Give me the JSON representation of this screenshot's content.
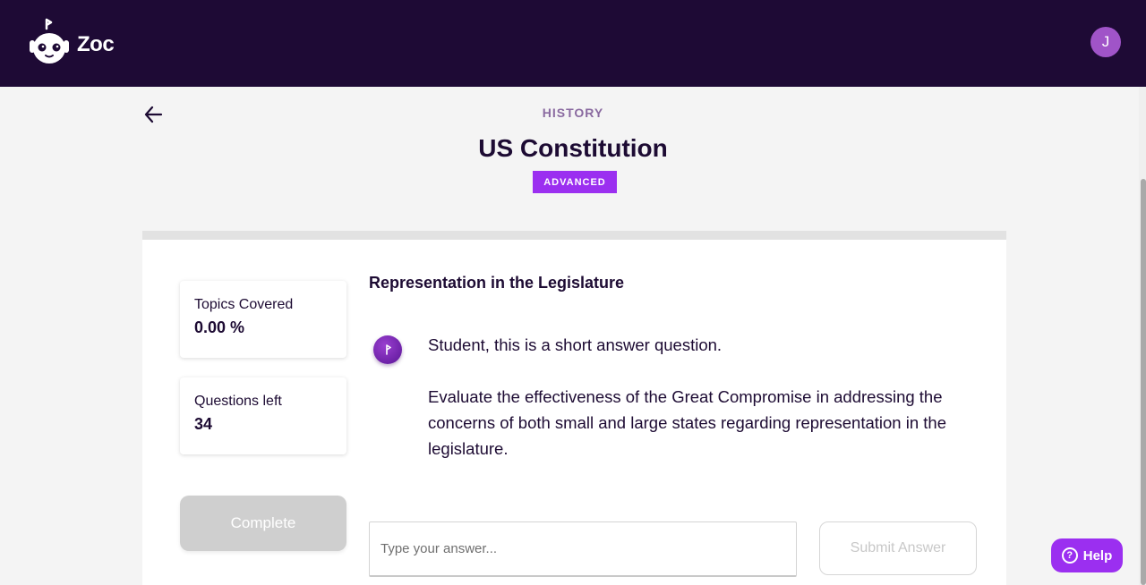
{
  "header": {
    "brand": "Zoc",
    "avatar_initial": "J"
  },
  "lesson": {
    "subject": "HISTORY",
    "title": "US Constitution",
    "level": "ADVANCED"
  },
  "stats": {
    "topics_covered_label": "Topics Covered",
    "topics_covered_value": "0.00 %",
    "questions_left_label": "Questions left",
    "questions_left_value": "34"
  },
  "actions": {
    "complete_label": "Complete",
    "submit_label": "Submit Answer",
    "help_label": "Help",
    "help_icon": "?"
  },
  "question": {
    "topic": "Representation in the Legislature",
    "intro": "Student, this is a short answer question.",
    "prompt": "Evaluate the effectiveness of the Great Compromise in addressing the concerns of both small and large states regarding representation in the legislature."
  },
  "answer": {
    "placeholder": "Type your answer..."
  },
  "colors": {
    "header_bg": "#1e0a35",
    "accent": "#9b2ff0",
    "avatar_bg": "#a054c8"
  }
}
